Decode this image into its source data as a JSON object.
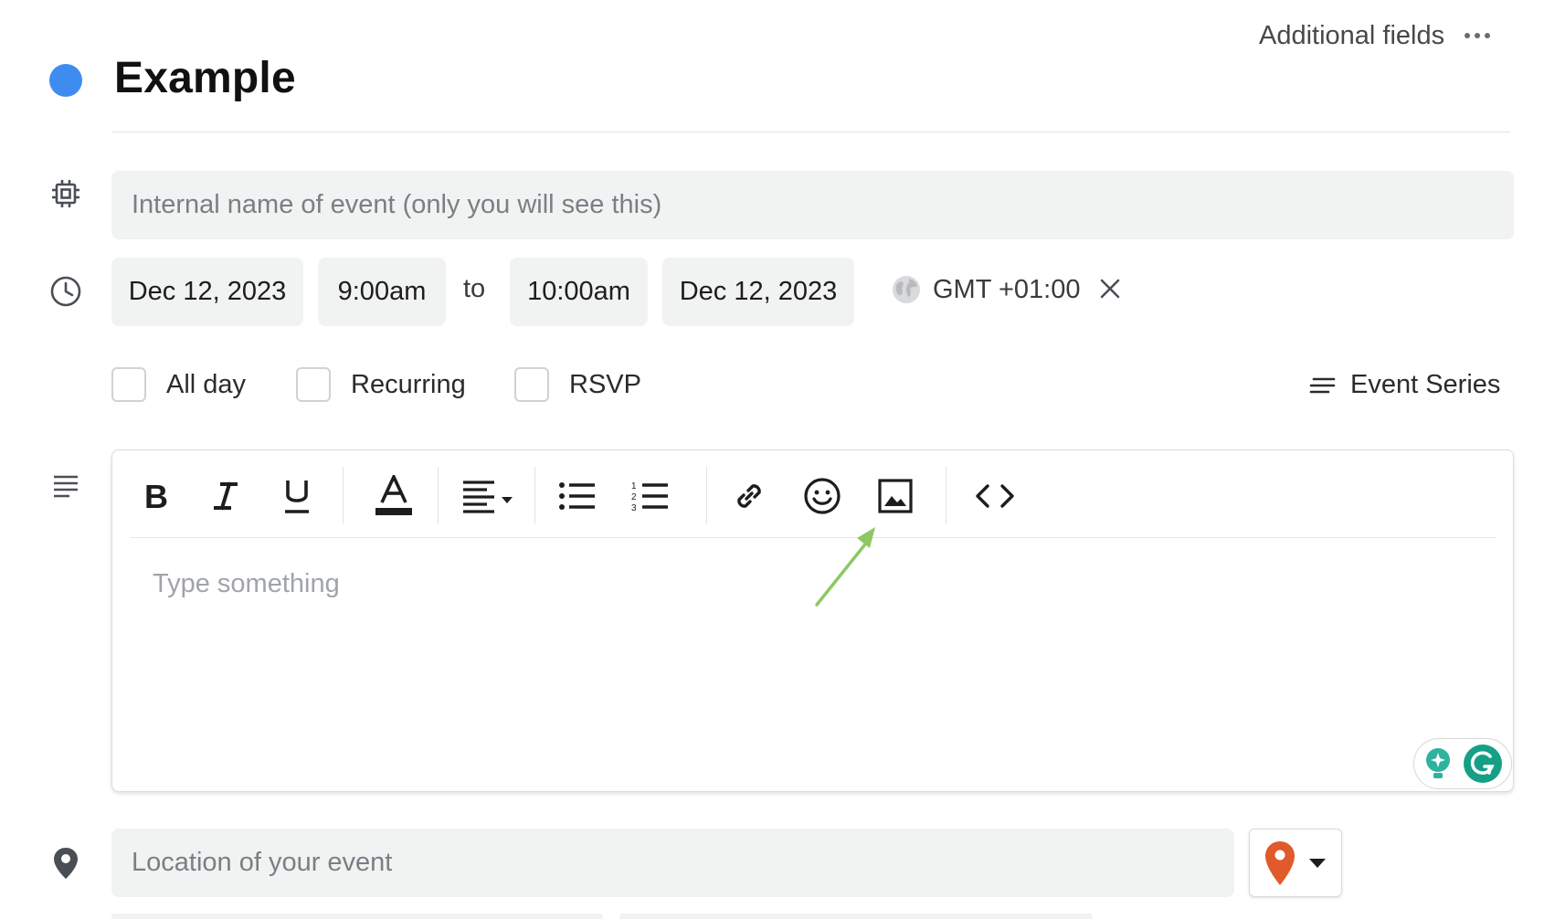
{
  "header": {
    "additional_fields_label": "Additional fields",
    "event_title": "Example",
    "event_color": "#3f8cf0"
  },
  "internal_name": {
    "icon": "chip-icon",
    "placeholder": "Internal name of event (only you will see this)",
    "value": ""
  },
  "datetime": {
    "icon": "clock-icon",
    "start_date": "Dec 12, 2023",
    "start_time": "9:00am",
    "separator": "to",
    "end_time": "10:00am",
    "end_date": "Dec 12, 2023",
    "timezone": "GMT +01:00"
  },
  "options": {
    "all_day": {
      "label": "All day",
      "checked": false
    },
    "recurring": {
      "label": "Recurring",
      "checked": false
    },
    "rsvp": {
      "label": "RSVP",
      "checked": false
    },
    "event_series_label": "Event Series"
  },
  "editor": {
    "icon": "description-icon",
    "placeholder": "Type something",
    "toolbar": [
      "bold-icon",
      "italic-icon",
      "underline-icon",
      "text-color-icon",
      "align-icon",
      "bullet-list-icon",
      "numbered-list-icon",
      "link-icon",
      "emoji-icon",
      "image-icon",
      "code-icon"
    ],
    "annotation_arrow_color": "#8dc863"
  },
  "location": {
    "icon": "location-pin-icon",
    "placeholder": "Location of your event",
    "value": "",
    "map_pin_color": "#e05a2b"
  }
}
